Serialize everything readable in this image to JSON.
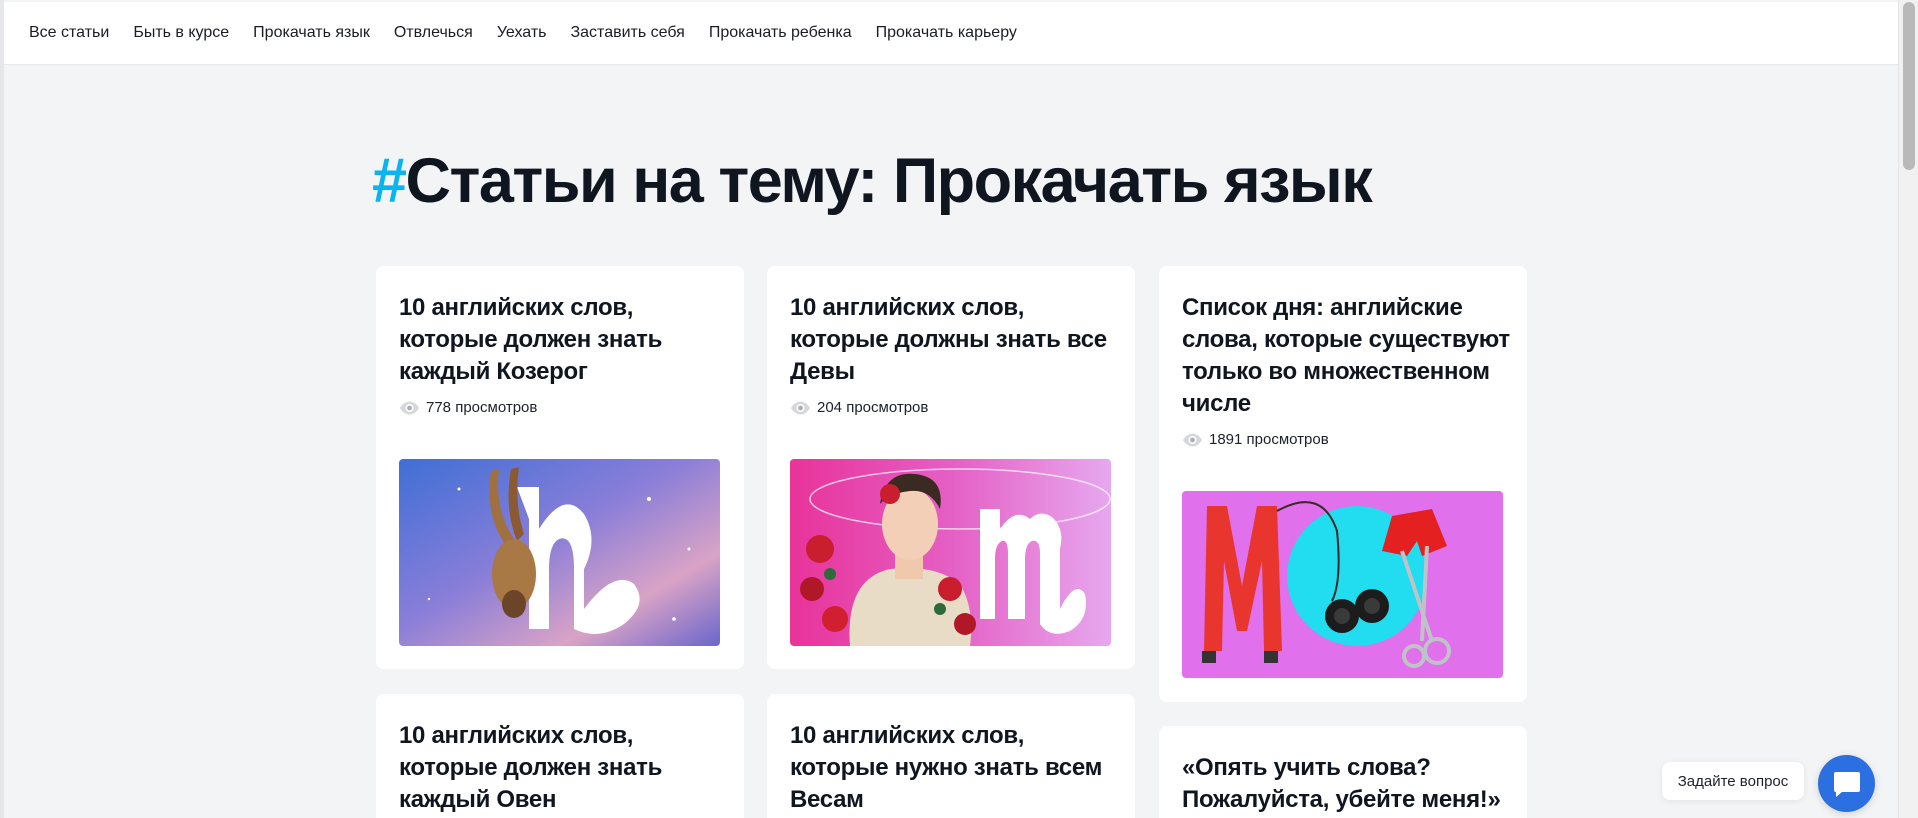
{
  "nav": {
    "items": [
      {
        "label": "Все статьи"
      },
      {
        "label": "Быть в курсе"
      },
      {
        "label": "Прокачать язык"
      },
      {
        "label": "Отвлечься"
      },
      {
        "label": "Уехать"
      },
      {
        "label": "Заставить себя"
      },
      {
        "label": "Прокачать ребенка"
      },
      {
        "label": "Прокачать карьеру"
      }
    ]
  },
  "page": {
    "title_hash": "#",
    "title": "Статьи на тему: Прокачать язык"
  },
  "cards": [
    {
      "title": "10 английских слов, которые должен знать каждый Козерог",
      "views": "778 просмотров",
      "image": "capricorn-ibex-zodiac-image"
    },
    {
      "title": "10 английских слов, которые должны знать все Девы",
      "views": "204 просмотров",
      "image": "virgo-man-roses-zodiac-image"
    },
    {
      "title": "Список дня: английские слова, которые существуют только во множественном числе",
      "views": "1891 просмотров",
      "image": "suspenders-binoculars-scissors-image"
    },
    {
      "title": "10 английских слов, которые должен знать каждый Овен"
    },
    {
      "title": "10 английских слов, которые нужно знать всем Весам"
    },
    {
      "title": "«Опять учить слова? Пожалуйста, убейте меня!»"
    }
  ],
  "chat": {
    "label": "Задайте вопрос",
    "icon": "chat-bubble-icon"
  },
  "colors": {
    "accent_hash": "#0ab4f0",
    "chat_button": "#2c6fe0",
    "background": "#f3f4f6"
  }
}
